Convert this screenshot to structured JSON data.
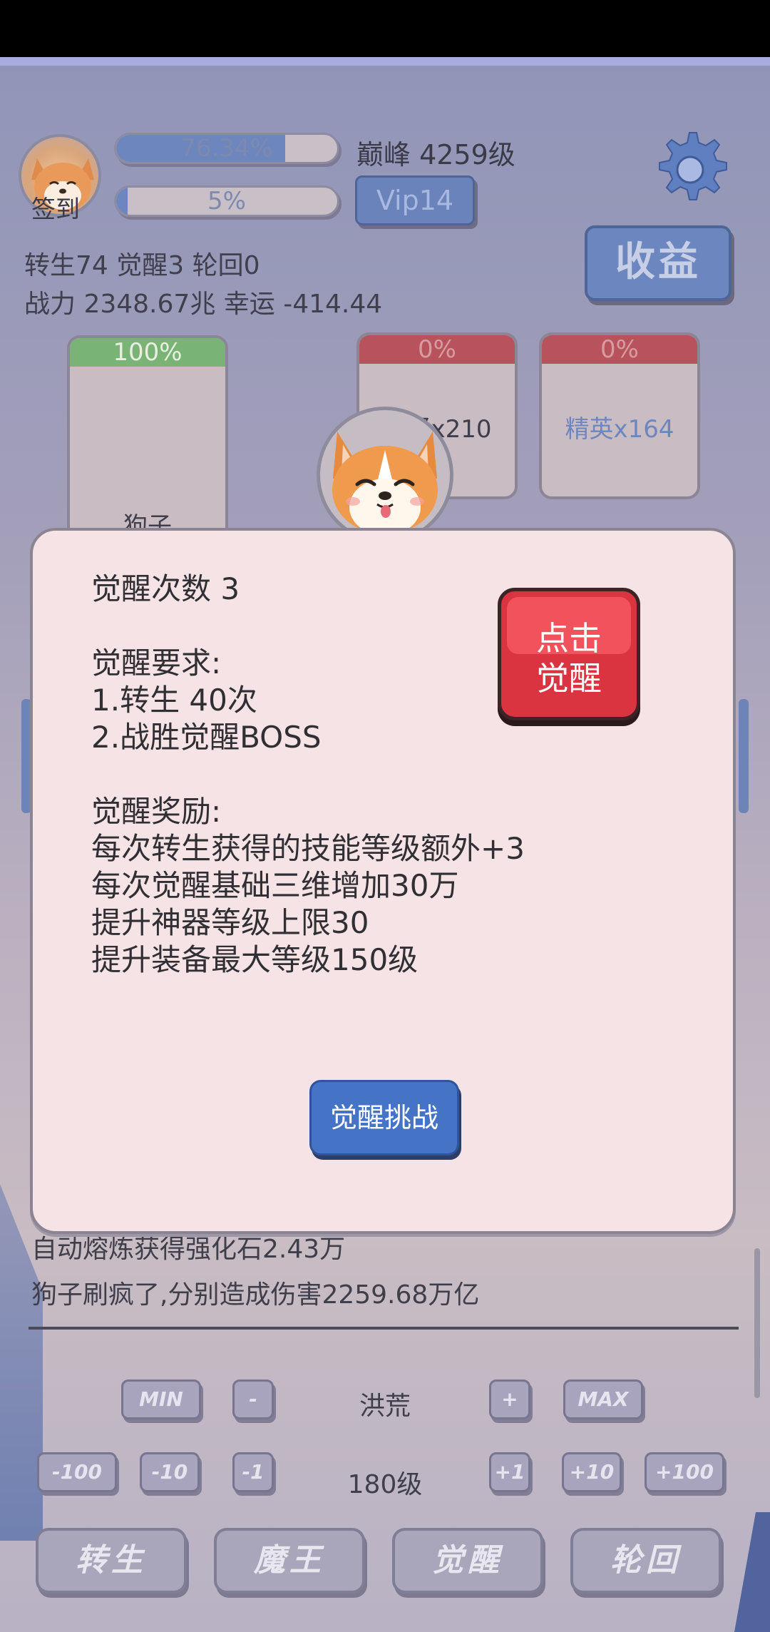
{
  "header": {
    "checkin_label": "签到",
    "exp_bar": {
      "progress": 0.7634,
      "text": "76.34%"
    },
    "second_bar": {
      "progress": 0.05,
      "text": "5%"
    },
    "peak_label": "巅峰 4259级",
    "vip_label": "Vip14",
    "income_label": "收益",
    "stats_line1": "转生74 觉醒3 轮回0",
    "stats_line2": "战力 2348.67兆  幸运 -414.44"
  },
  "cards": [
    {
      "percent": "100%",
      "name": "狗子",
      "status": "green"
    },
    {
      "percent": "0%",
      "name": "小怪x210",
      "status": "red"
    },
    {
      "percent": "0%",
      "name": "精英x164",
      "status": "red",
      "name_color": "#6d86be"
    }
  ],
  "modal": {
    "awaken_count": "觉醒次数 3",
    "requirements_title": "觉醒要求:",
    "requirements": [
      "1.转生 40次",
      "2.战胜觉醒BOSS"
    ],
    "rewards_title": "觉醒奖励:",
    "rewards": [
      "每次转生获得的技能等级额外+3",
      "每次觉醒基础三维增加30万",
      "提升神器等级上限30",
      "提升装备最大等级150级"
    ],
    "awaken_button": "点击\n觉醒",
    "challenge_button": "觉醒挑战"
  },
  "log": {
    "lines": [
      "自动熔炼获得强化石2.43万",
      "狗子刷疯了,分别造成伤害2259.68万亿"
    ]
  },
  "controls": {
    "row1": {
      "min": "MIN",
      "minus": "-",
      "label": "洪荒",
      "plus": "+",
      "max": "MAX"
    },
    "row2": {
      "m100": "-100",
      "m10": "-10",
      "m1": "-1",
      "label": "180级",
      "p1": "+1",
      "p10": "+10",
      "p100": "+100"
    }
  },
  "bottom_buttons": [
    "转生",
    "魔王",
    "觉醒",
    "轮回"
  ],
  "colors": {
    "accent_blue": "#4574c6",
    "awaken_red": "#d9343f",
    "modal_bg": "#f6e3e6"
  }
}
